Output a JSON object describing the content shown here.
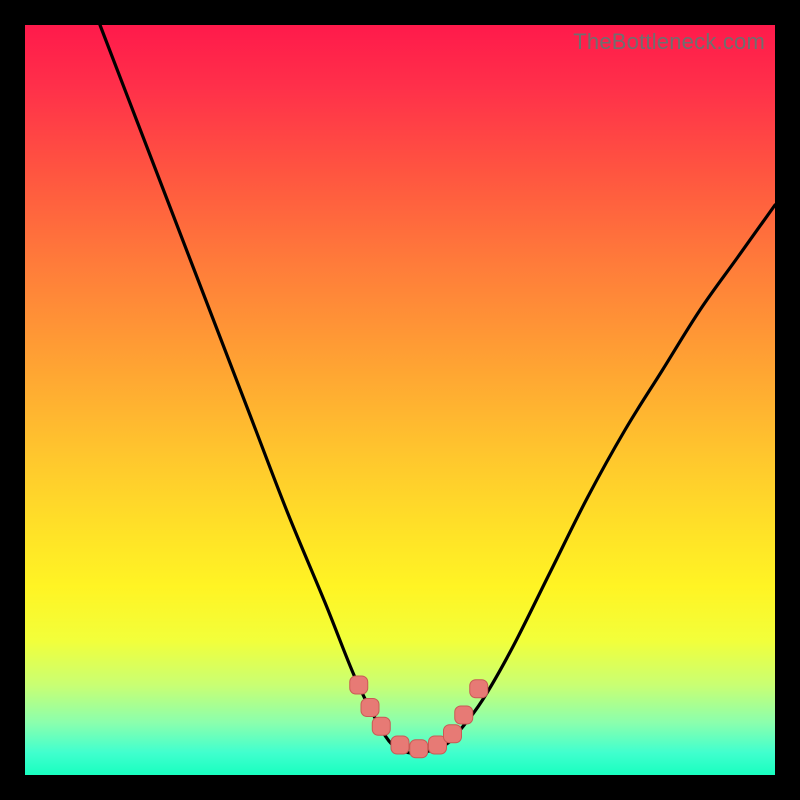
{
  "watermark": "TheBottleneck.com",
  "colors": {
    "frame": "#000000",
    "curve_stroke": "#000000",
    "marker_fill": "#e77a75",
    "marker_stroke": "#c95a55",
    "gradient_stops": [
      "#ff1a4b",
      "#ff5640",
      "#ffa233",
      "#ffe327",
      "#f2ff3a",
      "#8bffad",
      "#18ffc0"
    ]
  },
  "chart_data": {
    "type": "line",
    "title": "",
    "xlabel": "",
    "ylabel": "",
    "xlim": [
      0,
      100
    ],
    "ylim": [
      0,
      100
    ],
    "note": "Axis values are relative percentages of the plot area (no numeric tick labels are shown in the image). y≈0 at curve trough, y≈100 at top edge.",
    "series": [
      {
        "name": "bottleneck-curve",
        "x": [
          10,
          15,
          20,
          25,
          30,
          35,
          40,
          44,
          47,
          49,
          51,
          53,
          56,
          58,
          61,
          65,
          70,
          75,
          80,
          85,
          90,
          95,
          100
        ],
        "y": [
          100,
          87,
          74,
          61,
          48,
          35,
          23,
          13,
          7,
          4,
          3,
          3,
          4,
          6,
          10,
          17,
          27,
          37,
          46,
          54,
          62,
          69,
          76
        ]
      }
    ],
    "markers": {
      "name": "highlighted-points",
      "x": [
        44.5,
        46.0,
        47.5,
        50.0,
        52.5,
        55.0,
        57.0,
        58.5,
        60.5
      ],
      "y": [
        12.0,
        9.0,
        6.5,
        4.0,
        3.5,
        4.0,
        5.5,
        8.0,
        11.5
      ]
    }
  }
}
